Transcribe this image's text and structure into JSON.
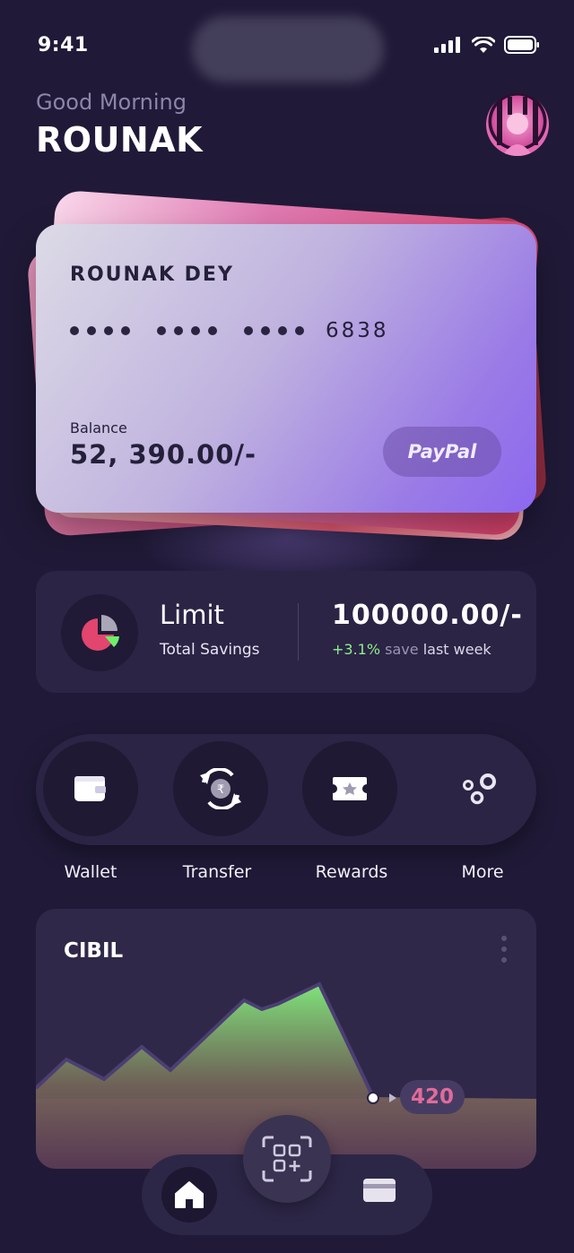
{
  "status_bar": {
    "time": "9:41"
  },
  "greeting": {
    "subtitle": "Good Morning",
    "name": "ROUNAK"
  },
  "card": {
    "holder": "ROUNAK DEY",
    "last4": "6838",
    "balance_label": "Balance",
    "balance_value": "52, 390.00/-",
    "brand": "PayPal"
  },
  "limit": {
    "title": "Limit",
    "subtitle": "Total Savings",
    "amount": "100000.00/-",
    "change": "+3.1%",
    "change_mid": "save",
    "change_suffix": "last week"
  },
  "actions": [
    {
      "label": "Wallet",
      "icon": "wallet-icon"
    },
    {
      "label": "Transfer",
      "icon": "rupee-transfer-icon"
    },
    {
      "label": "Rewards",
      "icon": "ticket-icon"
    },
    {
      "label": "More",
      "icon": "more-circles-icon"
    }
  ],
  "cibil": {
    "title": "CIBIL",
    "score": "420"
  },
  "nav": {
    "items": [
      "home-icon",
      "scan-qr-icon",
      "card-icon"
    ]
  },
  "colors": {
    "background": "#201a38",
    "accent_green": "#8ef08b",
    "accent_pink": "#e16b9a",
    "card_purple": "#8c68ef"
  }
}
